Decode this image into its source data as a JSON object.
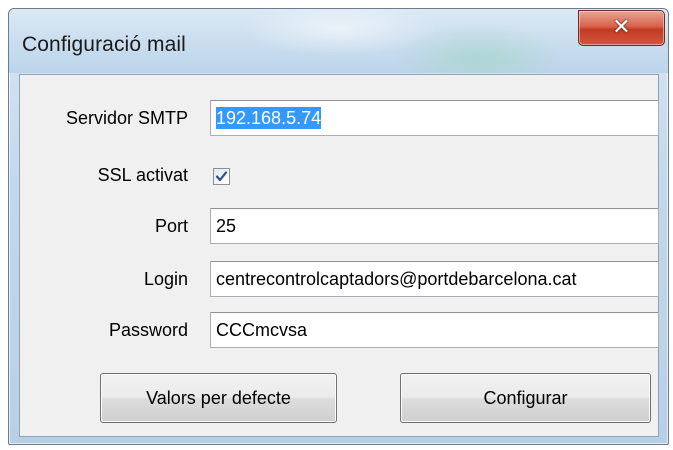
{
  "window": {
    "title": "Configuració mail",
    "close_glyph": "✕"
  },
  "form": {
    "smtp_label": "Servidor SMTP",
    "smtp_value": "192.168.5.74",
    "ssl_label": "SSL activat",
    "ssl_checked": true,
    "port_label": "Port",
    "port_value": "25",
    "login_label": "Login",
    "login_value": "centrecontrolcaptadors@portdebarcelona.cat",
    "password_label": "Password",
    "password_value": "CCCmcvsa"
  },
  "buttons": {
    "defaults_label": "Valors per defecte",
    "configure_label": "Configurar"
  },
  "icons": {
    "close": "close-icon",
    "check": "checkmark-icon"
  },
  "colors": {
    "selection": "#3399ff",
    "close_button": "#c8402a",
    "checkmark": "#2b4f8a"
  }
}
